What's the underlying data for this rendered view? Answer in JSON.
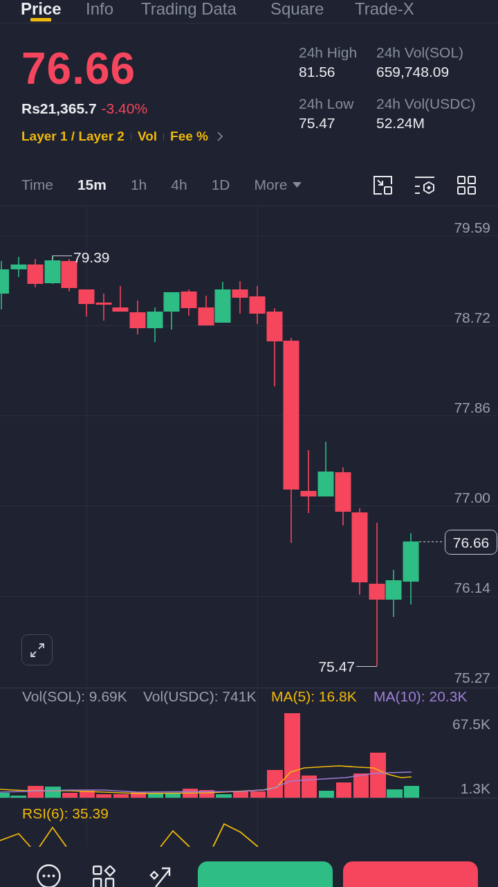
{
  "tabs": [
    {
      "label": "Price",
      "selected": true
    },
    {
      "label": "Info",
      "selected": false
    },
    {
      "label": "Trading Data",
      "selected": false
    },
    {
      "label": "Square",
      "selected": false
    },
    {
      "label": "Trade-X",
      "selected": false
    }
  ],
  "ticker": {
    "last_price": "76.66",
    "falling": true,
    "fiat_value": "Rs21,365.7",
    "change": "-3.40%",
    "tags": [
      "Layer 1 / Layer 2",
      "Vol",
      "Fee %"
    ]
  },
  "stats": [
    {
      "label": "24h High",
      "value": "81.56"
    },
    {
      "label": "24h Vol(SOL)",
      "value": "659,748.09"
    },
    {
      "label": "24h Low",
      "value": "75.47"
    },
    {
      "label": "24h Vol(USDC)",
      "value": "52.24M"
    }
  ],
  "intervals": [
    {
      "label": "Time",
      "kind": "option",
      "selected": false
    },
    {
      "label": "15m",
      "kind": "option",
      "selected": true
    },
    {
      "label": "1h",
      "kind": "option",
      "selected": false
    },
    {
      "label": "4h",
      "kind": "option",
      "selected": false
    },
    {
      "label": "1D",
      "kind": "option",
      "selected": false
    },
    {
      "label": "More",
      "kind": "menu",
      "selected": false
    }
  ],
  "chart": {
    "price_axis": [
      "79.59",
      "78.72",
      "77.86",
      "77.00",
      "76.14",
      "75.27"
    ],
    "high_label": "79.39",
    "low_label": "75.47",
    "last_price_tag": "76.66"
  },
  "volume": {
    "legend": [
      {
        "text": "Vol(SOL): 9.69K",
        "color": "#9aa0aa"
      },
      {
        "text": "Vol(USDC): 741K",
        "color": "#9aa0aa"
      },
      {
        "text": "MA(5): 16.8K",
        "color": "#f0b90b"
      },
      {
        "text": "MA(10): 20.3K",
        "color": "#9f7fd6"
      }
    ],
    "axis": [
      "67.5K",
      "1.3K"
    ]
  },
  "rsi": {
    "label": "RSI(6): 35.39"
  },
  "actions": [
    {
      "kind": "buy"
    },
    {
      "kind": "sell"
    }
  ]
}
